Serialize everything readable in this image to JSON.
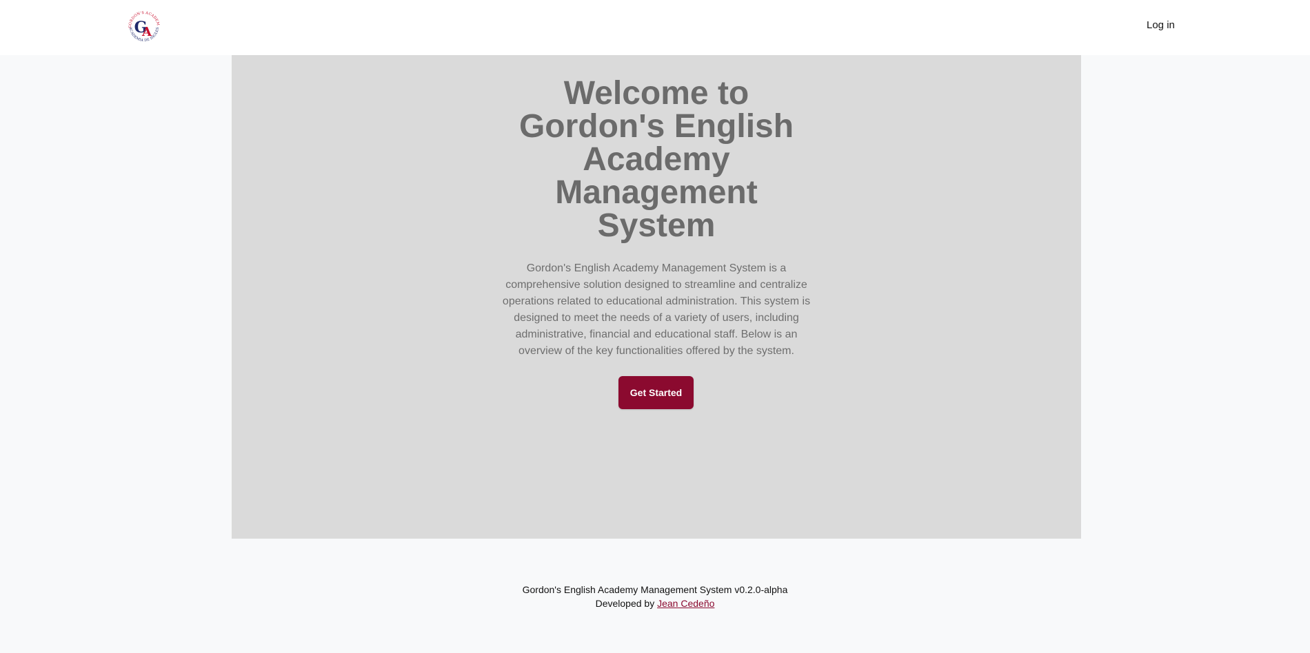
{
  "header": {
    "logo": {
      "top_text": "GORDON'S ACADEMY",
      "bottom_text": "ACADEMIA DE INGLES",
      "monogram": "GA"
    },
    "login_label": "Log in"
  },
  "hero": {
    "title": "Welcome to Gordon's English Academy Management System",
    "description": "Gordon's English Academy Management System is a comprehensive solution designed to streamline and centralize operations related to educational administration. This system is designed to meet the needs of a variety of users, including administrative, financial and educational staff. Below is an overview of the key functionalities offered by the system.",
    "cta_label": "Get Started"
  },
  "footer": {
    "version_line": "Gordon's English Academy Management System v0.2.0-alpha",
    "developed_by_prefix": "Developed by ",
    "developer_name": "Jean Cedeño"
  },
  "colors": {
    "accent": "#8b0a2f",
    "hero_bg": "#dadada",
    "page_bg": "#f8f9fa",
    "logo_red": "#c8102e",
    "logo_blue": "#1f2a6b"
  }
}
